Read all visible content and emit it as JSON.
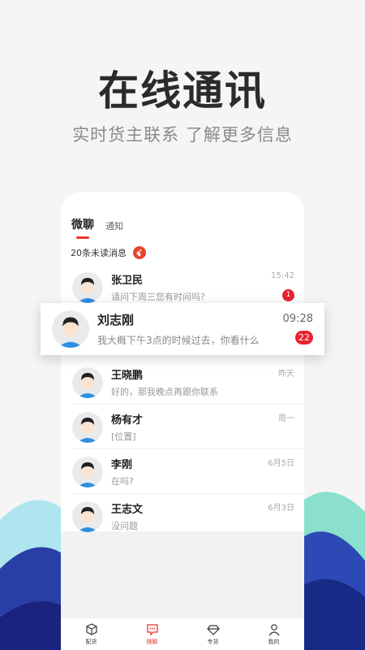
{
  "hero": {
    "title": "在线通讯",
    "subtitle": "实时货主联系  了解更多信息"
  },
  "tabs": [
    {
      "label": "微聊",
      "active": true
    },
    {
      "label": "通知",
      "active": false
    }
  ],
  "unread": {
    "text": "20条未读消息",
    "icon": "broom-icon"
  },
  "conversations": [
    {
      "name": "张卫民",
      "preview": "请问下周三您有时间吗?",
      "time": "15:42",
      "badge": "1"
    },
    {
      "name": "王晓鹏",
      "preview": "好的，那我晚点再跟你联系",
      "time": "昨天",
      "badge": ""
    },
    {
      "name": "杨有才",
      "preview": "[位置]",
      "time": "周一",
      "badge": ""
    },
    {
      "name": "李刚",
      "preview": "在吗?",
      "time": "6月5日",
      "badge": ""
    },
    {
      "name": "王志文",
      "preview": "没问题",
      "time": "6月3日",
      "badge": ""
    }
  ],
  "popup": {
    "name": "刘志刚",
    "preview": "我大概下午3点的时候过去，你看什么",
    "time": "09:28",
    "badge": "22"
  },
  "nav": [
    {
      "label": "配货",
      "icon": "box-icon"
    },
    {
      "label": "微聊",
      "icon": "chat-icon"
    },
    {
      "label": "专货",
      "icon": "diamond-icon"
    },
    {
      "label": "我的",
      "icon": "user-icon"
    }
  ],
  "colors": {
    "accent": "#e8382e",
    "badge": "#e8222e",
    "wave_teal": "#7fd8c8",
    "wave_navy": "#1c2f8f"
  }
}
